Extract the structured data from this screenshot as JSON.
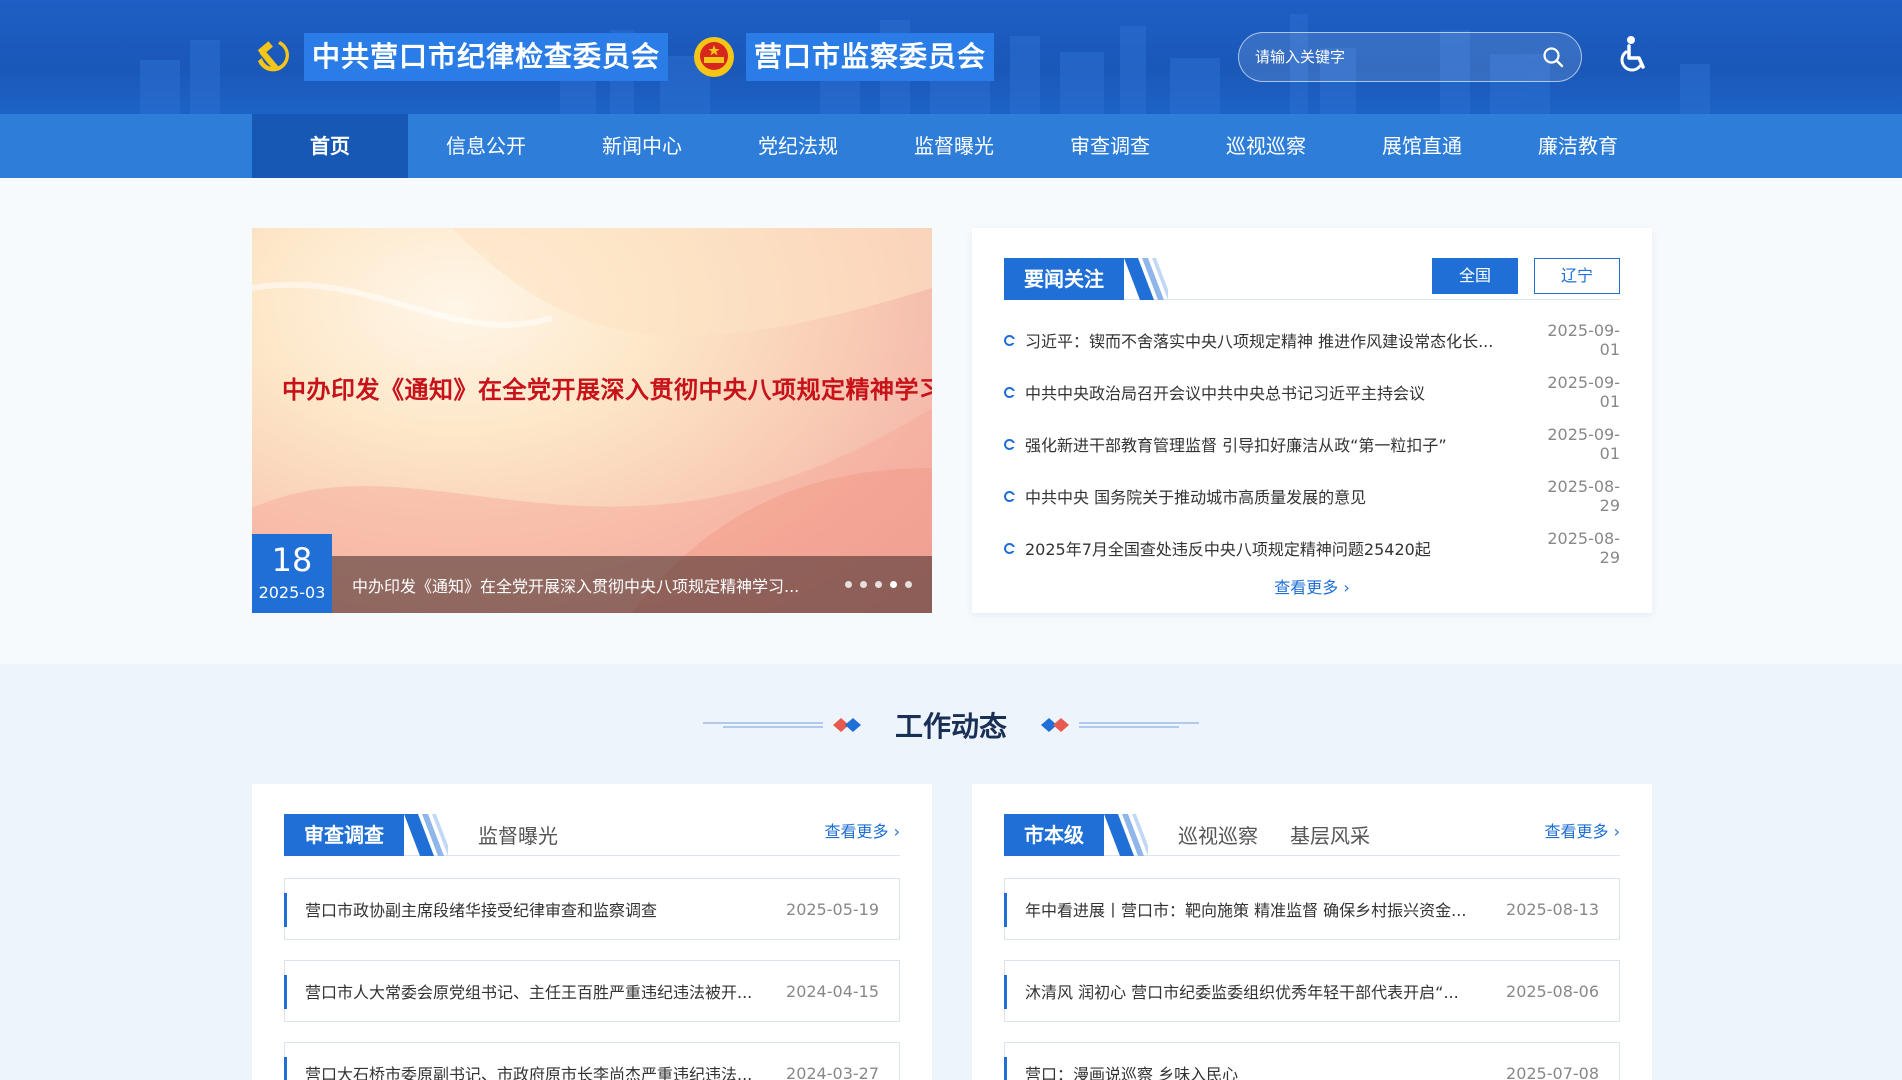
{
  "header": {
    "title_left": "中共营口市纪律检查委员会",
    "title_right": "营口市监察委员会",
    "search_placeholder": "请输入关键字"
  },
  "nav": {
    "items": [
      {
        "label": "首页",
        "active": true
      },
      {
        "label": "信息公开"
      },
      {
        "label": "新闻中心"
      },
      {
        "label": "党纪法规"
      },
      {
        "label": "监督曝光"
      },
      {
        "label": "审查调查"
      },
      {
        "label": "巡视巡察"
      },
      {
        "label": "展馆直通"
      },
      {
        "label": "廉洁教育"
      }
    ]
  },
  "banner": {
    "headline": "中办印发《通知》在全党开展深入贯彻中央八项规定精神学习教育",
    "day": "18",
    "year_month": "2025-03",
    "caption": "中办印发《通知》在全党开展深入贯彻中央八项规定精神学习...",
    "dot_count": 5,
    "active_dot": 3
  },
  "news": {
    "title": "要闻关注",
    "switch": [
      "全国",
      "辽宁"
    ],
    "items": [
      {
        "text": "习近平：锲而不舍落实中央八项规定精神 推进作风建设常态化长...",
        "date": "2025-09-01"
      },
      {
        "text": "中共中央政治局召开会议中共中央总书记习近平主持会议",
        "date": "2025-09-01"
      },
      {
        "text": "强化新进干部教育管理监督 引导扣好廉洁从政“第一粒扣子”",
        "date": "2025-09-01"
      },
      {
        "text": "中共中央 国务院关于推动城市高质量发展的意见",
        "date": "2025-08-29"
      },
      {
        "text": "2025年7月全国查处违反中央八项规定精神问题25420起",
        "date": "2025-08-29"
      }
    ],
    "more": "查看更多 ›"
  },
  "section": {
    "title": "工作动态"
  },
  "left_panel": {
    "tab_active": "审查调查",
    "tab_other": [
      "监督曝光"
    ],
    "more": "查看更多 ›",
    "items": [
      {
        "text": "营口市政协副主席段绪华接受纪律审查和监察调查",
        "date": "2025-05-19"
      },
      {
        "text": "营口市人大常委会原党组书记、主任王百胜严重违纪违法被开...",
        "date": "2024-04-15"
      },
      {
        "text": "营口大石桥市委原副书记、市政府原市长李尚杰严重违纪违法...",
        "date": "2024-03-27"
      }
    ]
  },
  "right_panel": {
    "tab_active": "市本级",
    "tab_other": [
      "巡视巡察",
      "基层风采"
    ],
    "more": "查看更多 ›",
    "items": [
      {
        "text": "年中看进展丨营口市：靶向施策 精准监督 确保乡村振兴资金...",
        "date": "2025-08-13"
      },
      {
        "text": "沐清风 润初心 营口市纪委监委组织优秀年轻干部代表开启“...",
        "date": "2025-08-06"
      },
      {
        "text": "营口：漫画说巡察 乡味入民心",
        "date": "2025-07-08"
      }
    ]
  }
}
